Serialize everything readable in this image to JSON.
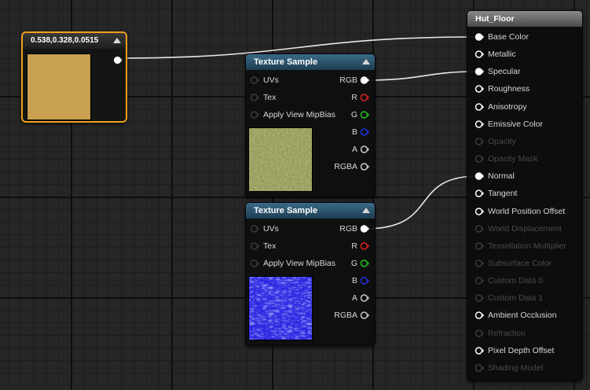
{
  "editor": {
    "background": "#262626",
    "wire_color": "#e8e8e8"
  },
  "constant_node": {
    "title": "0.538,0.328,0.0515",
    "swatch_color": "#c8a050",
    "border_color": "#f0a01e"
  },
  "texture_nodes": [
    {
      "title": "Texture Sample",
      "inputs": [
        {
          "label": "UVs",
          "connected": false
        },
        {
          "label": "Tex",
          "connected": false
        },
        {
          "label": "Apply View MipBias",
          "connected": false
        }
      ],
      "outputs": [
        {
          "label": "RGB",
          "color": "#ffffff",
          "connected": true
        },
        {
          "label": "R",
          "color": "#e02020",
          "connected": false
        },
        {
          "label": "G",
          "color": "#20c020",
          "connected": false
        },
        {
          "label": "B",
          "color": "#2030e0",
          "connected": false
        },
        {
          "label": "A",
          "color": "#c8c8c8",
          "connected": false
        },
        {
          "label": "RGBA",
          "color": "#c8c8c8",
          "connected": false
        }
      ],
      "preview": "grass-texture"
    },
    {
      "title": "Texture Sample",
      "inputs": [
        {
          "label": "UVs",
          "connected": false
        },
        {
          "label": "Tex",
          "connected": false
        },
        {
          "label": "Apply View MipBias",
          "connected": false
        }
      ],
      "outputs": [
        {
          "label": "RGB",
          "color": "#ffffff",
          "connected": true
        },
        {
          "label": "R",
          "color": "#e02020",
          "connected": false
        },
        {
          "label": "G",
          "color": "#20c020",
          "connected": false
        },
        {
          "label": "B",
          "color": "#2030e0",
          "connected": false
        },
        {
          "label": "A",
          "color": "#c8c8c8",
          "connected": false
        },
        {
          "label": "RGBA",
          "color": "#c8c8c8",
          "connected": false
        }
      ],
      "preview": "normal-map-texture"
    }
  ],
  "material_node": {
    "title": "Hut_Floor",
    "inputs": [
      {
        "label": "Base Color",
        "enabled": true,
        "connected": true
      },
      {
        "label": "Metallic",
        "enabled": true,
        "connected": false
      },
      {
        "label": "Specular",
        "enabled": true,
        "connected": true
      },
      {
        "label": "Roughness",
        "enabled": true,
        "connected": false
      },
      {
        "label": "Anisotropy",
        "enabled": true,
        "connected": false
      },
      {
        "label": "Emissive Color",
        "enabled": true,
        "connected": false
      },
      {
        "label": "Opacity",
        "enabled": false,
        "connected": false
      },
      {
        "label": "Opacity Mask",
        "enabled": false,
        "connected": false
      },
      {
        "label": "Normal",
        "enabled": true,
        "connected": true
      },
      {
        "label": "Tangent",
        "enabled": true,
        "connected": false
      },
      {
        "label": "World Position Offset",
        "enabled": true,
        "connected": false
      },
      {
        "label": "World Displacement",
        "enabled": false,
        "connected": false
      },
      {
        "label": "Tessellation Multiplier",
        "enabled": false,
        "connected": false
      },
      {
        "label": "Subsurface Color",
        "enabled": false,
        "connected": false
      },
      {
        "label": "Custom Data 0",
        "enabled": false,
        "connected": false
      },
      {
        "label": "Custom Data 1",
        "enabled": false,
        "connected": false
      },
      {
        "label": "Ambient Occlusion",
        "enabled": true,
        "connected": false
      },
      {
        "label": "Refraction",
        "enabled": false,
        "connected": false
      },
      {
        "label": "Pixel Depth Offset",
        "enabled": true,
        "connected": false
      },
      {
        "label": "Shading Model",
        "enabled": false,
        "connected": false
      }
    ]
  }
}
